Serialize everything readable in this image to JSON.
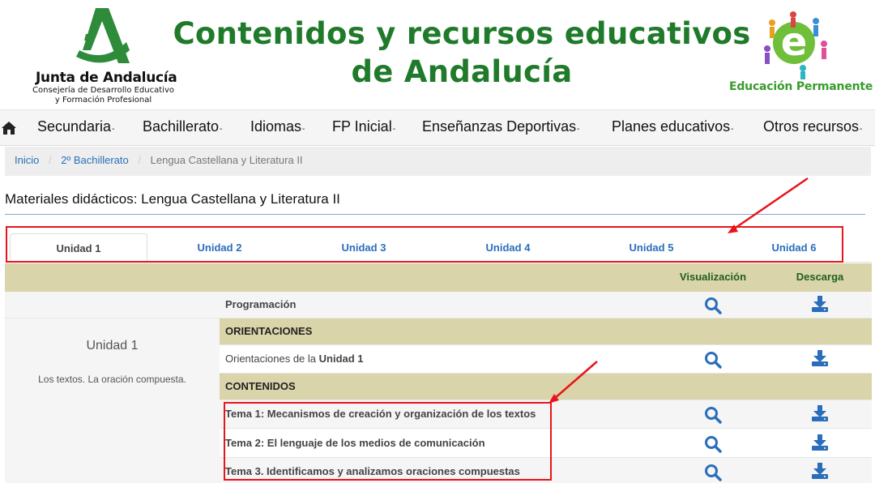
{
  "header": {
    "org_name": "Junta de Andalucía",
    "org_sub_1": "Consejería de Desarrollo Educativo",
    "org_sub_2": "y Formación Profesional",
    "site_title_1": "Contenidos y recursos educativos",
    "site_title_2": "de Andalucía",
    "ep_text": "Educación Permanente",
    "colors": {
      "title_green": "#1f7a2a",
      "ep_green": "#3a9b2e",
      "logo_green": "#2e8b3a"
    }
  },
  "nav": {
    "home_icon": "home-icon",
    "items": [
      {
        "label": "Secundaria"
      },
      {
        "label": "Bachillerato"
      },
      {
        "label": "Idiomas"
      },
      {
        "label": "FP Inicial"
      },
      {
        "label": "Enseñanzas Deportivas"
      },
      {
        "label": "Planes educativos"
      },
      {
        "label": "Otros recursos"
      }
    ],
    "caret": "-"
  },
  "breadcrumb": {
    "items": [
      "Inicio",
      "2º Bachillerato"
    ],
    "current": "Lengua Castellana y Literatura II",
    "separator": "/"
  },
  "page": {
    "heading": "Materiales didácticos: Lengua Castellana y Literatura II"
  },
  "tabs": [
    {
      "label": "Unidad 1",
      "active": true
    },
    {
      "label": "Unidad 2"
    },
    {
      "label": "Unidad 3"
    },
    {
      "label": "Unidad 4"
    },
    {
      "label": "Unidad 5"
    },
    {
      "label": "Unidad 6"
    }
  ],
  "table": {
    "headers": {
      "view": "Visualización",
      "download": "Descarga"
    },
    "programacion": "Programación",
    "unit_title": "Unidad 1",
    "unit_desc": "Los textos. La oración compuesta.",
    "section_orientaciones": "ORIENTACIONES",
    "orientaciones_prefix": "Orientaciones de la",
    "orientaciones_bold": "Unidad 1",
    "section_contenidos": "CONTENIDOS",
    "temas": [
      "Tema 1: Mecanismos de creación y organización de los textos",
      "Tema 2: El lenguaje de los medios de comunicación",
      "Tema 3. Identificamos y analizamos oraciones compuestas"
    ],
    "icons": {
      "view": "search-icon",
      "download": "download-icon"
    },
    "colors": {
      "header_bg": "#d9d4aa",
      "header_text": "#1f5f1f",
      "icon_blue": "#2a6ebb"
    }
  },
  "annotations": {
    "color": "#e8141b"
  }
}
